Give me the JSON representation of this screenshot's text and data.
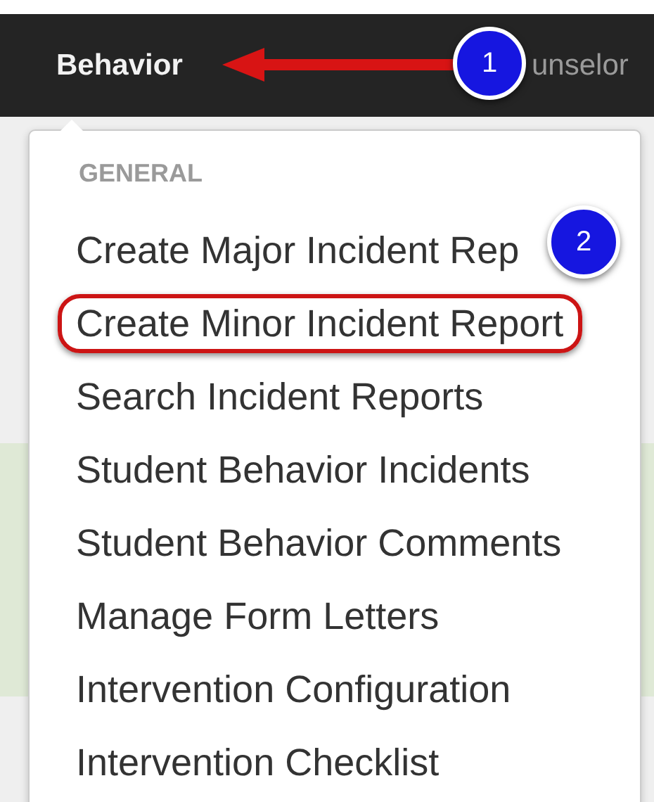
{
  "nav": {
    "items": [
      {
        "label": "Behavior",
        "selected": true
      },
      {
        "label": "unselor",
        "selected": false
      }
    ]
  },
  "menu": {
    "header": "GENERAL",
    "items": [
      {
        "label": "Create Major Incident Rep",
        "circled": false
      },
      {
        "label": "Create Minor Incident Report",
        "circled": true
      },
      {
        "label": "Search Incident Reports",
        "circled": false
      },
      {
        "label": "Student Behavior Incidents",
        "circled": false
      },
      {
        "label": "Student Behavior Comments",
        "circled": false
      },
      {
        "label": "Manage Form Letters",
        "circled": false
      },
      {
        "label": "Intervention Configuration",
        "circled": false
      },
      {
        "label": "Intervention Checklist",
        "circled": false
      }
    ]
  },
  "annotations": [
    {
      "label": "1"
    },
    {
      "label": "2"
    }
  ]
}
